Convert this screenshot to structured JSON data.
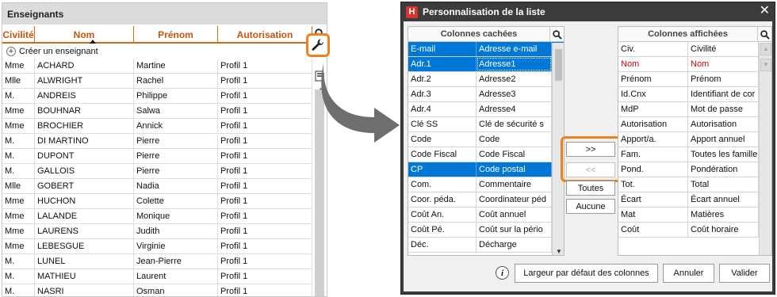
{
  "left_panel": {
    "title": "Enseignants",
    "columns": [
      "Civilité",
      "Nom",
      "Prénom",
      "Autorisation"
    ],
    "create_label": "Créer un enseignant",
    "rows": [
      [
        "Mme",
        "ACHARD",
        "Martine",
        "Profil 1"
      ],
      [
        "Mlle",
        "ALWRIGHT",
        "Rachel",
        "Profil 1"
      ],
      [
        "M.",
        "ANDREIS",
        "Philippe",
        "Profil 1"
      ],
      [
        "Mme",
        "BOUHNAR",
        "Salwa",
        "Profil 1"
      ],
      [
        "Mme",
        "BROCHIER",
        "Annick",
        "Profil 1"
      ],
      [
        "M.",
        "DI MARTINO",
        "Pierre",
        "Profil 1"
      ],
      [
        "M.",
        "DUPONT",
        "Pierre",
        "Profil 1"
      ],
      [
        "M.",
        "GALLOIS",
        "Pierre",
        "Profil 1"
      ],
      [
        "Mlle",
        "GOBERT",
        "Nadia",
        "Profil 1"
      ],
      [
        "Mme",
        "HUCHON",
        "Colette",
        "Profil 1"
      ],
      [
        "Mme",
        "LALANDE",
        "Monique",
        "Profil 1"
      ],
      [
        "Mme",
        "LAURENS",
        "Judith",
        "Profil 1"
      ],
      [
        "Mme",
        "LEBESGUE",
        "Virginie",
        "Profil 1"
      ],
      [
        "M.",
        "LUNEL",
        "Jean-Pierre",
        "Profil 1"
      ],
      [
        "M.",
        "MATHIEU",
        "Laurent",
        "Profil 1"
      ],
      [
        "M.",
        "NASRI",
        "Osman",
        "Profil 1"
      ]
    ]
  },
  "dialog": {
    "title": "Personnalisation de la liste",
    "logo_letter": "H",
    "hidden_header": "Colonnes cachées",
    "shown_header": "Colonnes affichées",
    "hidden_rows": [
      {
        "code": "E-mail",
        "label": "Adresse e-mail",
        "selected": true
      },
      {
        "code": "Adr.1",
        "label": "Adresse1",
        "selected": true,
        "focus": true
      },
      {
        "code": "Adr.2",
        "label": "Adresse2",
        "selected": false
      },
      {
        "code": "Adr.3",
        "label": "Adresse3",
        "selected": false
      },
      {
        "code": "Adr.4",
        "label": "Adresse4",
        "selected": false
      },
      {
        "code": "Clé SS",
        "label": "Clé de sécurité s",
        "selected": false
      },
      {
        "code": "Code",
        "label": "Code",
        "selected": false
      },
      {
        "code": "Code Fiscal",
        "label": "Code Fiscal",
        "selected": false
      },
      {
        "code": "CP",
        "label": "Code postal",
        "selected": true
      },
      {
        "code": "Com.",
        "label": "Commentaire",
        "selected": false
      },
      {
        "code": "Coor. péda.",
        "label": "Coordinateur péd",
        "selected": false
      },
      {
        "code": "Coût An.",
        "label": "Coût annuel",
        "selected": false
      },
      {
        "code": "Coût Pé.",
        "label": "Coût sur la pério",
        "selected": false
      },
      {
        "code": "Déc.",
        "label": "Décharge",
        "selected": false
      }
    ],
    "shown_rows": [
      {
        "code": "Civ.",
        "label": "Civilité",
        "red": false
      },
      {
        "code": "Nom",
        "label": "Nom",
        "red": true
      },
      {
        "code": "Prénom",
        "label": "Prénom",
        "red": false
      },
      {
        "code": "Id.Cnx",
        "label": "Identifiant de cor",
        "red": false
      },
      {
        "code": "MdP",
        "label": "Mot de passe",
        "red": false
      },
      {
        "code": "Autorisation",
        "label": "Autorisation",
        "red": false
      },
      {
        "code": "Apport/a.",
        "label": "Apport annuel",
        "red": false
      },
      {
        "code": "Fam.",
        "label": "Toutes les famille",
        "red": false
      },
      {
        "code": "Pond.",
        "label": "Pondération",
        "red": false
      },
      {
        "code": "Tot.",
        "label": "Total",
        "red": false
      },
      {
        "code": "Écart",
        "label": "Écart annuel",
        "red": false
      },
      {
        "code": "Mat",
        "label": "Matières",
        "red": false
      },
      {
        "code": "Coût",
        "label": "Coût horaire",
        "red": false
      }
    ],
    "btn_add": ">>",
    "btn_remove": "<<",
    "btn_all": "Toutes",
    "btn_none": "Aucune",
    "btn_default_width": "Largeur par défaut des colonnes",
    "btn_cancel": "Annuler",
    "btn_ok": "Valider",
    "close_symbol": "✕"
  },
  "colors": {
    "accent": "#f2811d",
    "header_text": "#c8560c",
    "selection": "#0078d7",
    "dialog_frame": "#3c3c3c"
  }
}
